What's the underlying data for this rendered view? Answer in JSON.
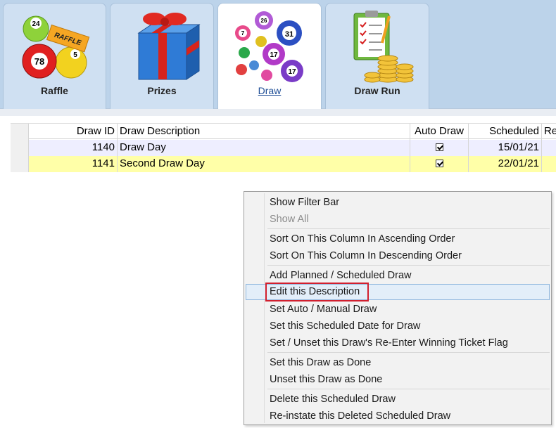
{
  "tabs": [
    {
      "label": "Raffle",
      "icon": "raffle-balls-icon",
      "active": false
    },
    {
      "label": "Prizes",
      "icon": "gift-box-icon",
      "active": false
    },
    {
      "label": "Draw",
      "icon": "lottery-balls-icon",
      "active": true
    },
    {
      "label": "Draw Run",
      "icon": "clipboard-coins-icon",
      "active": false
    }
  ],
  "raffle_art": {
    "ball1": "24",
    "ball2": "78",
    "ball3": "5",
    "ticket": "RAFFLE"
  },
  "draw_art": {
    "b1": "26",
    "b2": "7",
    "b3": "31",
    "b4": "17",
    "b5": "17"
  },
  "grid": {
    "columns": [
      "Draw ID",
      "Draw Description",
      "Auto Draw",
      "Scheduled",
      "Re"
    ],
    "rows": [
      {
        "draw_id": "1140",
        "description": "Draw Day",
        "auto_draw": true,
        "scheduled": "15/01/21"
      },
      {
        "draw_id": "1141",
        "description": "Second Draw Day",
        "auto_draw": true,
        "scheduled": "22/01/21"
      }
    ]
  },
  "context_menu": {
    "items": [
      "Show Filter Bar",
      "Show All",
      "Sort On This Column In Ascending Order",
      "Sort On This Column In Descending Order",
      "Add Planned / Scheduled Draw",
      "Edit this Description",
      "Set Auto / Manual Draw",
      "Set this Scheduled Date for Draw",
      "Set / Unset this Draw's Re-Enter Winning Ticket Flag",
      "Set this Draw as Done",
      "Unset this Draw as Done",
      "Delete this Scheduled Draw",
      "Re-instate this Deleted Scheduled Draw"
    ],
    "disabled_item": "Show All",
    "highlighted_item": "Edit this Description"
  },
  "colors": {
    "tabstrip_bg": "#bcd3ea",
    "active_tab_text": "#1f4e96",
    "row_selected_bg": "#ffffa8",
    "row_normal_bg": "#eeeeff",
    "highlight_box": "#d21f2e"
  }
}
